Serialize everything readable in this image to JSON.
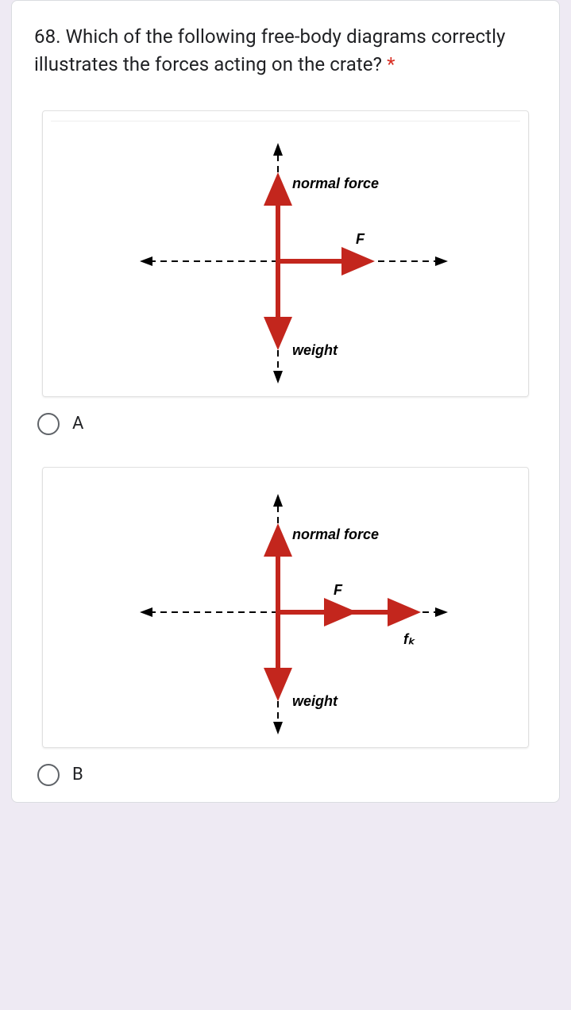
{
  "question": {
    "text": "68. Which of the following free-body diagrams correctly illustrates the forces acting on the crate? ",
    "required": "*"
  },
  "options": [
    {
      "label": "A"
    },
    {
      "label": "B"
    }
  ],
  "diagrams": {
    "A": {
      "labels": {
        "normal": "normal force",
        "F": "F",
        "weight": "weight"
      },
      "has_fk": false
    },
    "B": {
      "labels": {
        "normal": "normal force",
        "F": "F",
        "weight": "weight",
        "fk": "fₖ"
      },
      "has_fk": true
    }
  }
}
